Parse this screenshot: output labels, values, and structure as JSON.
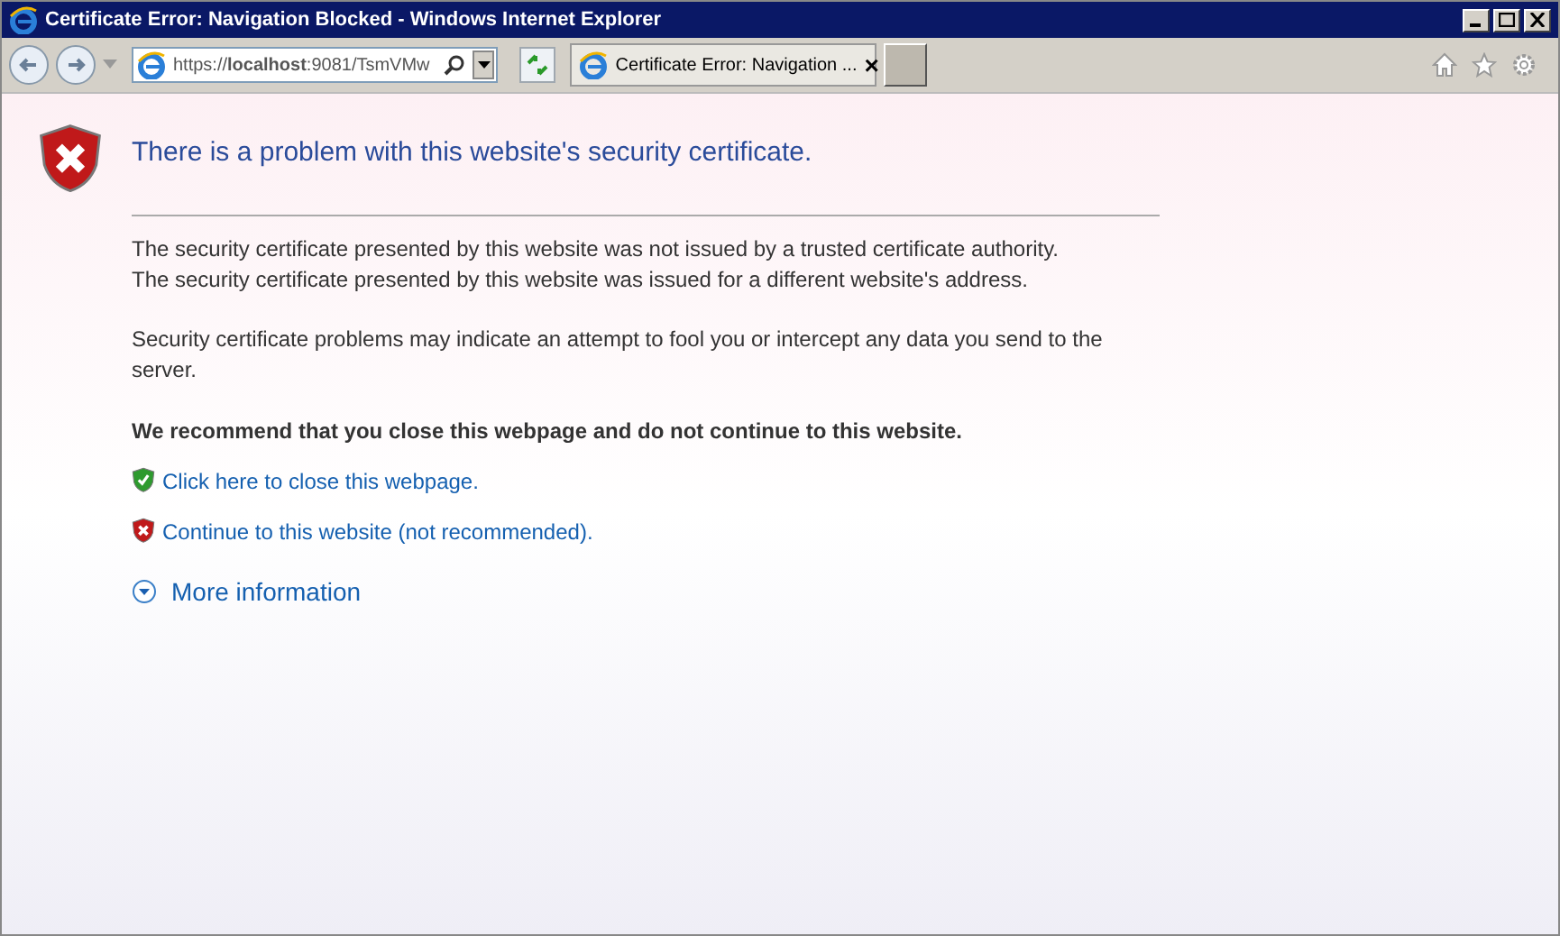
{
  "window": {
    "title": "Certificate Error: Navigation Blocked - Windows Internet Explorer"
  },
  "address_bar": {
    "url": "https://**localhost**:9081/TsmVMw"
  },
  "tabs": [
    {
      "label": "Certificate Error: Navigation ...",
      "selected": true,
      "close": "×"
    }
  ],
  "page": {
    "heading": "There is a problem with this website's security certificate.",
    "paragraphs": [
      "The security certificate presented by this website was not issued by a trusted certificate authority.\nThe security certificate presented by this website was issued for a different website's address.",
      "Security certificate problems may indicate an attempt to fool you or intercept any data you send to the server."
    ],
    "recommendation": "We recommend that you close this webpage and do not continue to this website.",
    "links": [
      {
        "kind": "safe",
        "label": "Click here to close this webpage."
      },
      {
        "kind": "unsafe",
        "label": "Continue to this website (not recommended)."
      }
    ],
    "more_info": {
      "label": "More information",
      "expanded": false
    }
  }
}
